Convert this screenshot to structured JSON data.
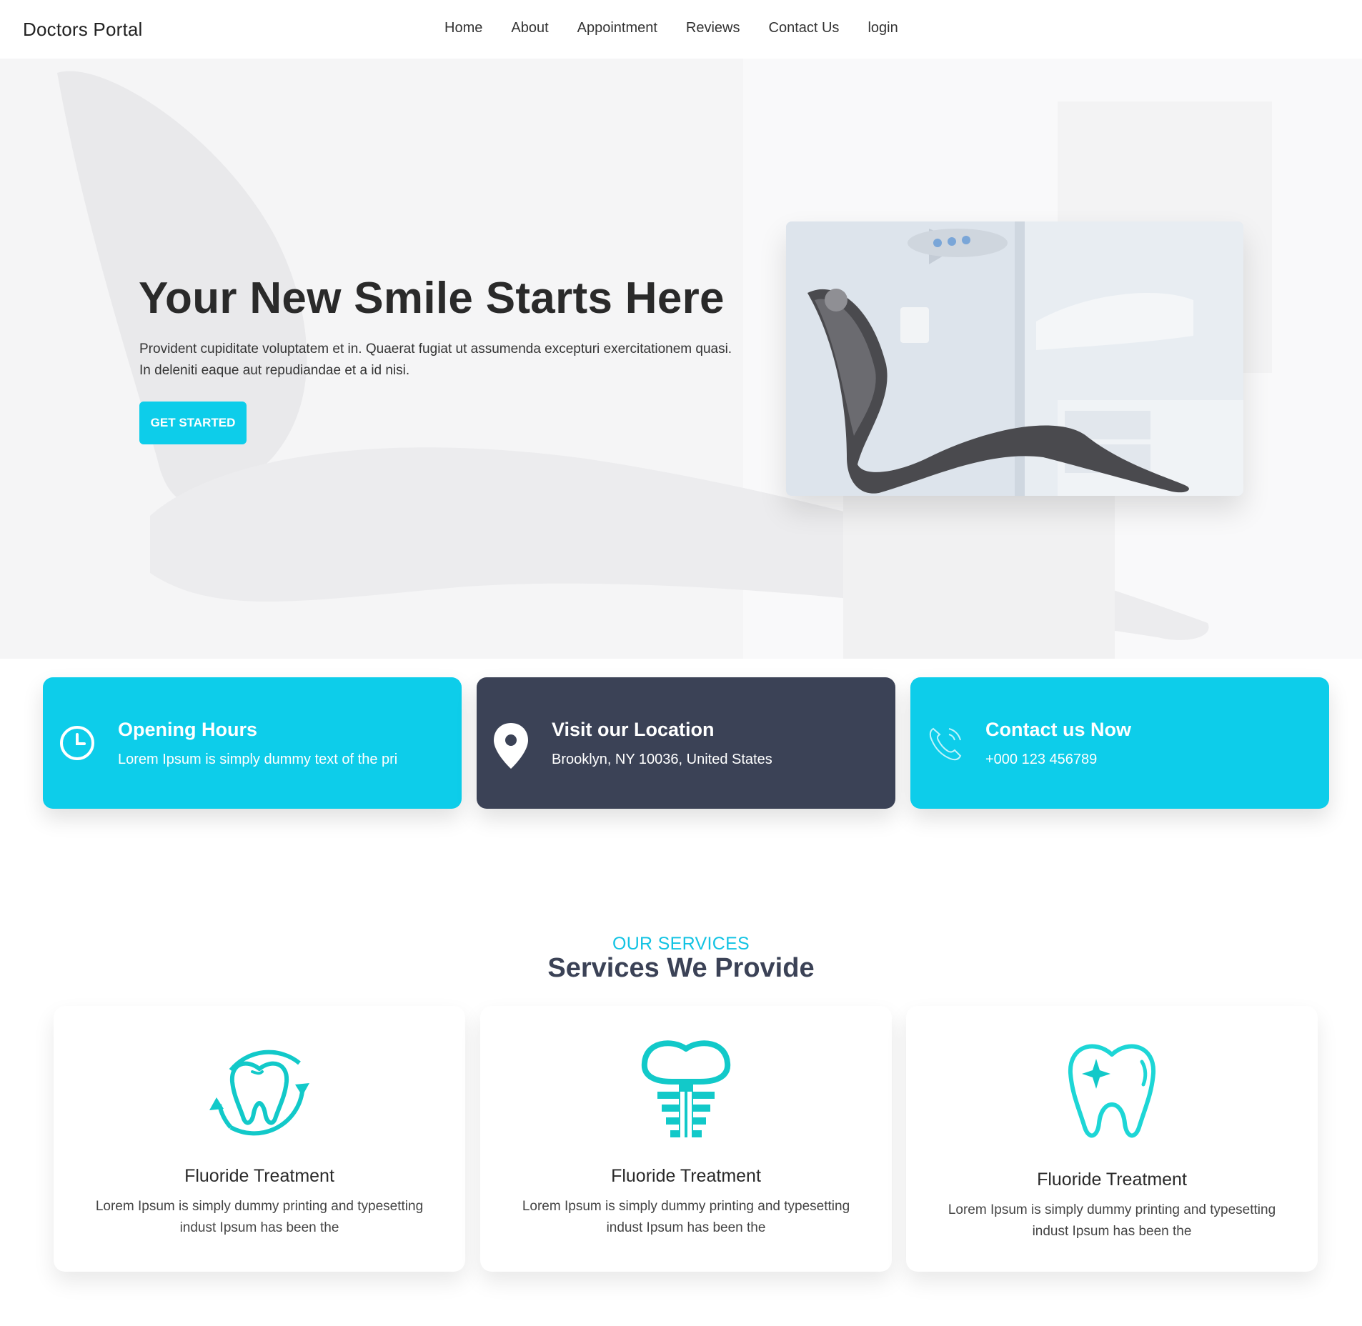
{
  "navbar": {
    "brand": "Doctors Portal",
    "links": [
      "Home",
      "About",
      "Appointment",
      "Reviews",
      "Contact Us",
      "login"
    ]
  },
  "hero": {
    "title": "Your New Smile Starts Here",
    "text": "Provident cupiditate voluptatem et in. Quaerat fugiat ut assumenda excepturi exercitationem quasi. In deleniti eaque aut repudiandae et a id nisi.",
    "button": "GET STARTED"
  },
  "info_cards": [
    {
      "title": "Opening Hours",
      "subtitle": "Lorem Ipsum is simply dummy text of the pri",
      "icon": "clock-icon",
      "color": "#0dcdea"
    },
    {
      "title": "Visit our Location",
      "subtitle": "Brooklyn, NY 10036, United States",
      "icon": "location-pin-icon",
      "color": "#3b4256"
    },
    {
      "title": "Contact us Now",
      "subtitle": "+000 123 456789",
      "icon": "phone-icon",
      "color": "#0dcdea"
    }
  ],
  "services": {
    "kicker": "OUR SERVICES",
    "heading": "Services We Provide",
    "items": [
      {
        "title": "Fluoride Treatment",
        "text": "Lorem Ipsum is simply dummy printing and typesetting indust Ipsum has been the",
        "icon": "tooth-cycle-icon"
      },
      {
        "title": "Fluoride Treatment",
        "text": "Lorem Ipsum is simply dummy printing and typesetting indust Ipsum has been the",
        "icon": "dental-implant-icon"
      },
      {
        "title": "Fluoride Treatment",
        "text": "Lorem Ipsum is simply dummy printing and typesetting indust Ipsum has been the",
        "icon": "tooth-sparkle-icon"
      }
    ]
  },
  "colors": {
    "accent": "#0dcdea",
    "dark": "#3b4256"
  }
}
